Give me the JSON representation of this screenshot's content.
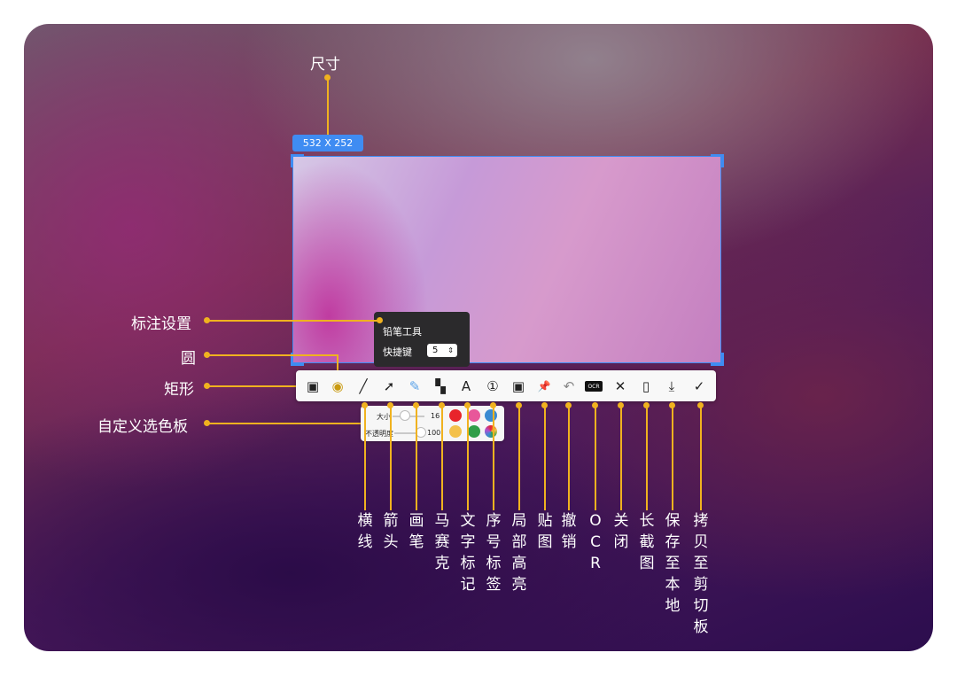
{
  "selection": {
    "size_label": "532  X  252"
  },
  "annotations": {
    "size": "尺寸",
    "mark_settings": "标注设置",
    "circle": "圆",
    "rectangle": "矩形",
    "custom_palette": "自定义选色板"
  },
  "pencil_popup": {
    "title": "铅笔工具",
    "shortcut_label": "快捷键",
    "shortcut_value": "5"
  },
  "palette": {
    "size_label": "大小",
    "size_value": "16",
    "opacity_label": "不透明度",
    "opacity_value": "100"
  },
  "colors": {
    "red": "#e8242b",
    "pink": "#e8579a",
    "blue": "#3a8ad2",
    "yellow": "#f4c14b",
    "green": "#2f9e48",
    "accent": "#f0b21f",
    "selection": "#3f8cf2"
  },
  "tools": [
    {
      "icon": "square-icon",
      "glyph": "▣",
      "label": ""
    },
    {
      "icon": "circle-icon",
      "glyph": "◉",
      "label": ""
    },
    {
      "icon": "line-icon",
      "glyph": "╱",
      "label": "横线"
    },
    {
      "icon": "arrow-icon",
      "glyph": "➚",
      "label": "箭头"
    },
    {
      "icon": "pencil-icon",
      "glyph": "✎",
      "label": "画笔"
    },
    {
      "icon": "mosaic-icon",
      "glyph": "▚",
      "label": "马赛克"
    },
    {
      "icon": "text-icon",
      "glyph": "A",
      "label": "文字标记"
    },
    {
      "icon": "number-icon",
      "glyph": "①",
      "label": "序号标签"
    },
    {
      "icon": "highlight-icon",
      "glyph": "▣",
      "label": "局部高亮"
    },
    {
      "icon": "pin-icon",
      "glyph": "📌",
      "label": "贴图"
    },
    {
      "icon": "undo-icon",
      "glyph": "↶",
      "label": "撤销"
    },
    {
      "icon": "ocr-icon",
      "glyph": "OCR",
      "label": "OCR"
    },
    {
      "icon": "close-icon",
      "glyph": "✕",
      "label": "关闭"
    },
    {
      "icon": "long-screenshot-icon",
      "glyph": "▯",
      "label": "长截图"
    },
    {
      "icon": "download-icon",
      "glyph": "⤓",
      "label": "保存至本地"
    },
    {
      "icon": "check-icon",
      "glyph": "✓",
      "label": "拷贝至剪切板"
    }
  ]
}
